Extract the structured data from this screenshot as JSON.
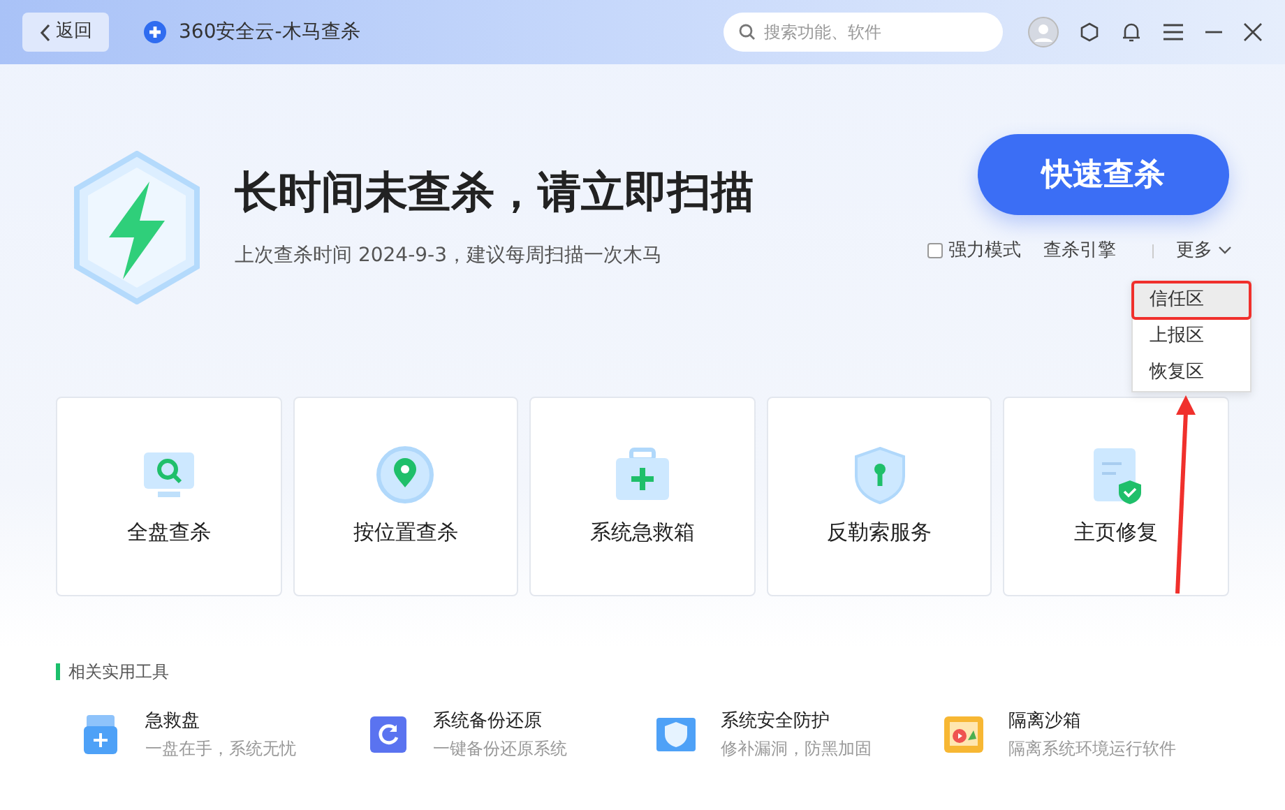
{
  "header": {
    "back_button": "返回",
    "app_title": "360安全云-木马查杀",
    "search": {
      "placeholder": "搜索功能、软件"
    }
  },
  "hero": {
    "title": "长时间未查杀，请立即扫描",
    "subtitle": "上次查杀时间 2024-9-3，建议每周扫描一次木马",
    "scan_button": "快速查杀",
    "options": [
      {
        "kind": "checkbox",
        "label": "强力模式",
        "checked": false
      },
      {
        "kind": "link",
        "label": "查杀引擎"
      }
    ],
    "more_menu": {
      "label": "更多",
      "expanded": true,
      "items": [
        {
          "label": "信任区",
          "selected": true,
          "annotated": true
        },
        {
          "label": "上报区",
          "selected": false,
          "annotated": false
        },
        {
          "label": "恢复区",
          "selected": false,
          "annotated": false
        }
      ]
    }
  },
  "features": [
    {
      "label": "全盘查杀"
    },
    {
      "label": "按位置查杀"
    },
    {
      "label": "系统急救箱"
    },
    {
      "label": "反勒索服务"
    },
    {
      "label": "主页修复"
    }
  ],
  "tools_section": {
    "title": "相关实用工具",
    "tools": [
      {
        "name": "急救盘",
        "description": "一盘在手，系统无忧"
      },
      {
        "name": "系统备份还原",
        "description": "一键备份还原系统"
      },
      {
        "name": "系统安全防护",
        "description": "修补漏洞，防黑加固"
      },
      {
        "name": "隔离沙箱",
        "description": "隔离系统环境运行软件"
      }
    ]
  }
}
